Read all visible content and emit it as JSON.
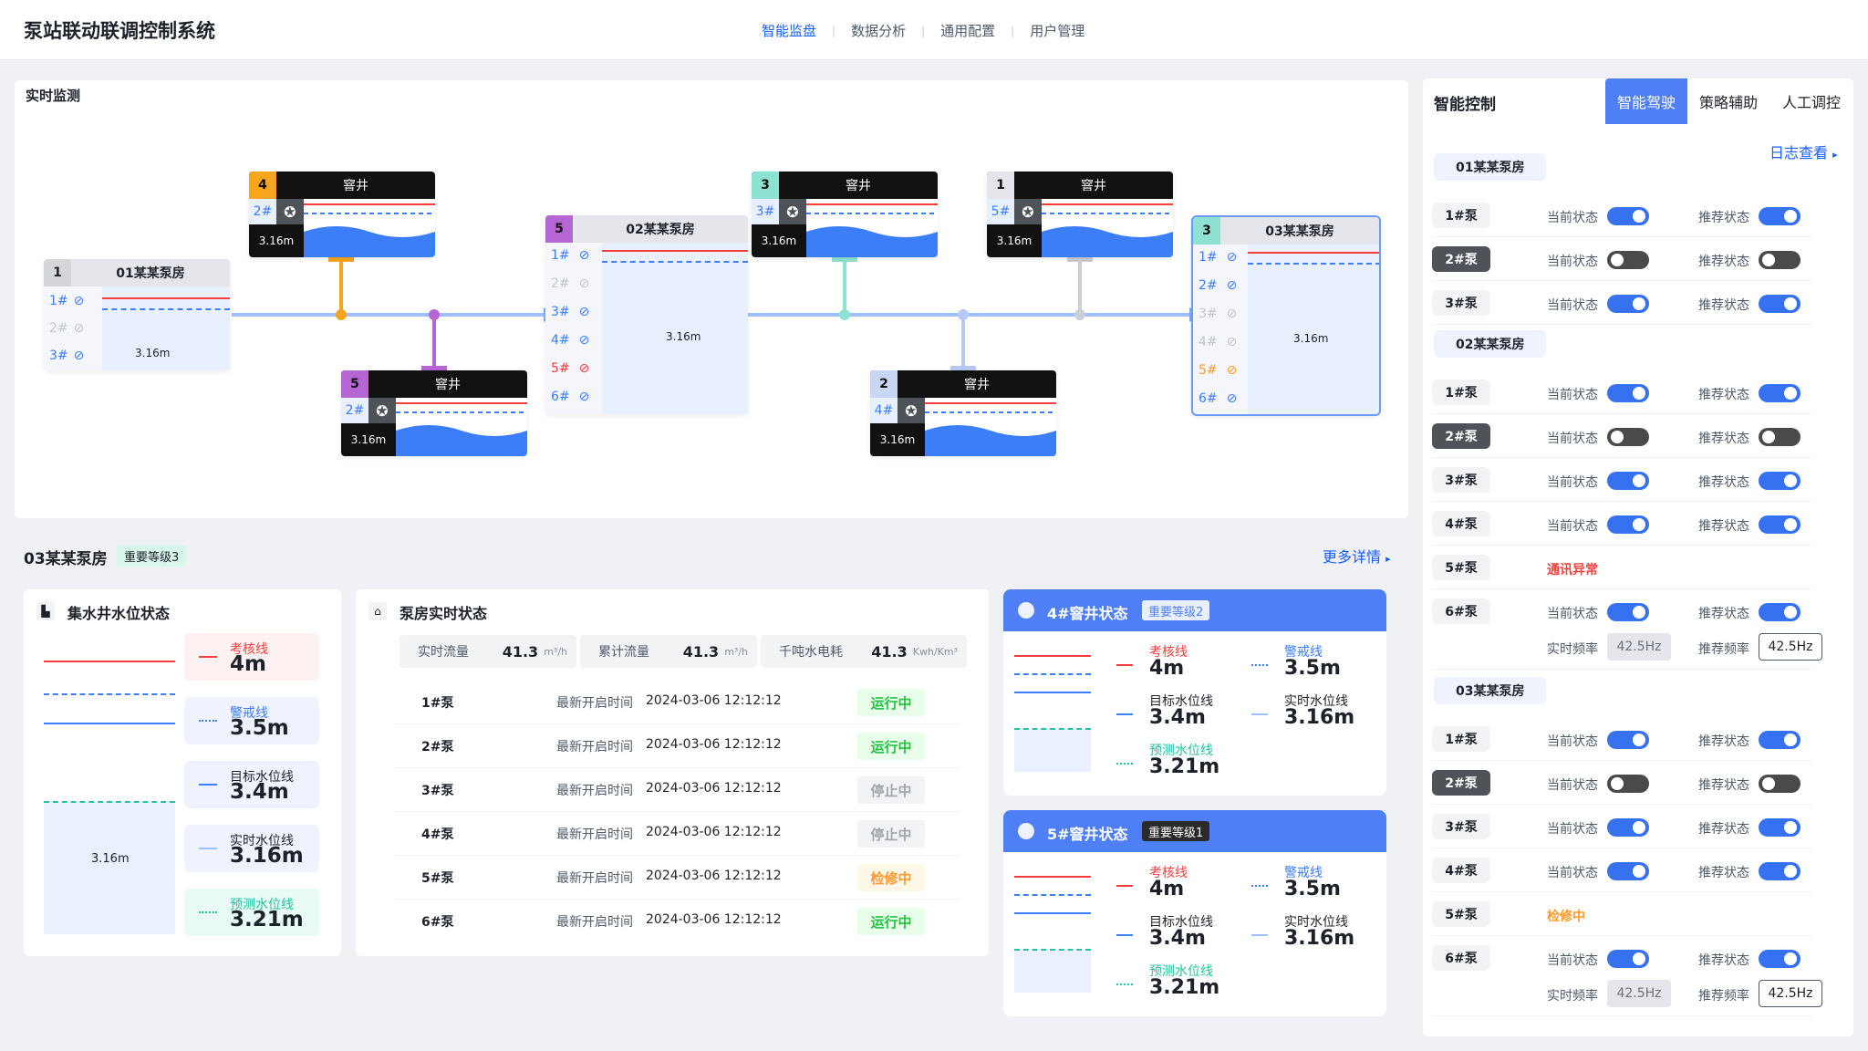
{
  "app_title": "泵站联动联调控制系统",
  "nav": [
    "智能监盘",
    "数据分析",
    "通用配置",
    "用户管理"
  ],
  "monitor": {
    "title": "实时监测",
    "stations": [
      {
        "num": "1",
        "name": "01某某泵房",
        "pumps": [
          "1#",
          "2#",
          "3#"
        ],
        "level": "3.16m"
      },
      {
        "num": "5",
        "name": "02某某泵房",
        "pumps": [
          "1#",
          "2#",
          "3#",
          "4#",
          "5#",
          "6#"
        ],
        "level": "3.16m"
      },
      {
        "num": "3",
        "name": "03某某泵房",
        "pumps": [
          "1#",
          "2#",
          "3#",
          "4#",
          "5#",
          "6#"
        ],
        "level": "3.16m"
      }
    ],
    "wells": [
      {
        "num": "4",
        "name": "窨井",
        "pump": "2#",
        "level": "3.16m"
      },
      {
        "num": "5",
        "name": "窨井",
        "pump": "2#",
        "level": "3.16m"
      },
      {
        "num": "3",
        "name": "窨井",
        "pump": "3#",
        "level": "3.16m"
      },
      {
        "num": "1",
        "name": "窨井",
        "pump": "5#",
        "level": "3.16m"
      },
      {
        "num": "2",
        "name": "窨井",
        "pump": "4#",
        "level": "3.16m"
      }
    ]
  },
  "detail": {
    "title": "03某某泵房",
    "badge": "重要等级3",
    "more": "更多详情",
    "sump_title": "集水井水位状态",
    "sump_level": "3.16m",
    "legend": [
      {
        "name": "考核线",
        "value": "4m"
      },
      {
        "name": "警戒线",
        "value": "3.5m"
      },
      {
        "name": "目标水位线",
        "value": "3.4m"
      },
      {
        "name": "实时水位线",
        "value": "3.16m"
      },
      {
        "name": "预测水位线",
        "value": "3.21m"
      }
    ],
    "pump_title": "泵房实时状态",
    "kpis": [
      {
        "label": "实时流量",
        "value": "41.3",
        "unit": "m³/h"
      },
      {
        "label": "累计流量",
        "value": "41.3",
        "unit": "m³/h"
      },
      {
        "label": "千吨水电耗",
        "value": "41.3",
        "unit": "Kwh/Km³"
      }
    ],
    "time_label": "最新开启时间",
    "rows": [
      {
        "pump": "1#泵",
        "time": "2024-03-06 12:12:12",
        "status": "运行中"
      },
      {
        "pump": "2#泵",
        "time": "2024-03-06 12:12:12",
        "status": "运行中"
      },
      {
        "pump": "3#泵",
        "time": "2024-03-06 12:12:12",
        "status": "停止中"
      },
      {
        "pump": "4#泵",
        "time": "2024-03-06 12:12:12",
        "status": "停止中"
      },
      {
        "pump": "5#泵",
        "time": "2024-03-06 12:12:12",
        "status": "检修中"
      },
      {
        "pump": "6#泵",
        "time": "2024-03-06 12:12:12",
        "status": "运行中"
      }
    ],
    "sumps": [
      {
        "title": "4#窨井状态",
        "badge": "重要等级2",
        "legend": [
          {
            "name": "考核线",
            "value": "4m"
          },
          {
            "name": "警戒线",
            "value": "3.5m"
          },
          {
            "name": "目标水位线",
            "value": "3.4m"
          },
          {
            "name": "实时水位线",
            "value": "3.16m"
          },
          {
            "name": "预测水位线",
            "value": "3.21m"
          }
        ]
      },
      {
        "title": "5#窨井状态",
        "badge": "重要等级1",
        "legend": [
          {
            "name": "考核线",
            "value": "4m"
          },
          {
            "name": "警戒线",
            "value": "3.5m"
          },
          {
            "name": "目标水位线",
            "value": "3.4m"
          },
          {
            "name": "实时水位线",
            "value": "3.16m"
          },
          {
            "name": "预测水位线",
            "value": "3.21m"
          }
        ]
      }
    ]
  },
  "control": {
    "title": "智能控制",
    "tabs": [
      "智能驾驶",
      "策略辅助",
      "人工调控"
    ],
    "log": "日志查看",
    "cur_label": "当前状态",
    "rec_label": "推荐状态",
    "freq_cur_label": "实时频率",
    "freq_rec_label": "推荐频率",
    "groups": [
      {
        "name": "01某某泵房",
        "pumps": [
          {
            "name": "1#泵",
            "cur": "on",
            "rec": "on"
          },
          {
            "name": "2#泵",
            "cur": "off",
            "rec": "off"
          },
          {
            "name": "3#泵",
            "cur": "on",
            "rec": "on"
          }
        ]
      },
      {
        "name": "02某某泵房",
        "pumps": [
          {
            "name": "1#泵",
            "cur": "on",
            "rec": "on"
          },
          {
            "name": "2#泵",
            "cur": "off",
            "rec": "off"
          },
          {
            "name": "3#泵",
            "cur": "on",
            "rec": "on"
          },
          {
            "name": "4#泵",
            "cur": "on",
            "rec": "on"
          },
          {
            "name": "5#泵",
            "msg": "通讯异常",
            "msg_color": "#f53f3f"
          },
          {
            "name": "6#泵",
            "cur": "on",
            "rec": "on",
            "freq_cur": "42.5Hz",
            "freq_rec": "42.5Hz"
          }
        ]
      },
      {
        "name": "03某某泵房",
        "pumps": [
          {
            "name": "1#泵",
            "cur": "on",
            "rec": "on"
          },
          {
            "name": "2#泵",
            "cur": "off",
            "rec": "off"
          },
          {
            "name": "3#泵",
            "cur": "on",
            "rec": "on"
          },
          {
            "name": "4#泵",
            "cur": "on",
            "rec": "on"
          },
          {
            "name": "5#泵",
            "msg": "检修中",
            "msg_color": "#ff9a2e"
          },
          {
            "name": "6#泵",
            "cur": "on",
            "rec": "on",
            "freq_cur": "42.5Hz",
            "freq_rec": "42.5Hz"
          }
        ]
      }
    ]
  },
  "colors": {
    "accent": "#165dff",
    "pipe": "#9ec0ff",
    "orange": "#f7a51c",
    "purple": "#b666d2",
    "teal": "#8ee2d2",
    "gray": "#c9cdd4",
    "exam": "#f53f3f",
    "warn": "#3c7ef7",
    "predict": "#23c3a0"
  }
}
